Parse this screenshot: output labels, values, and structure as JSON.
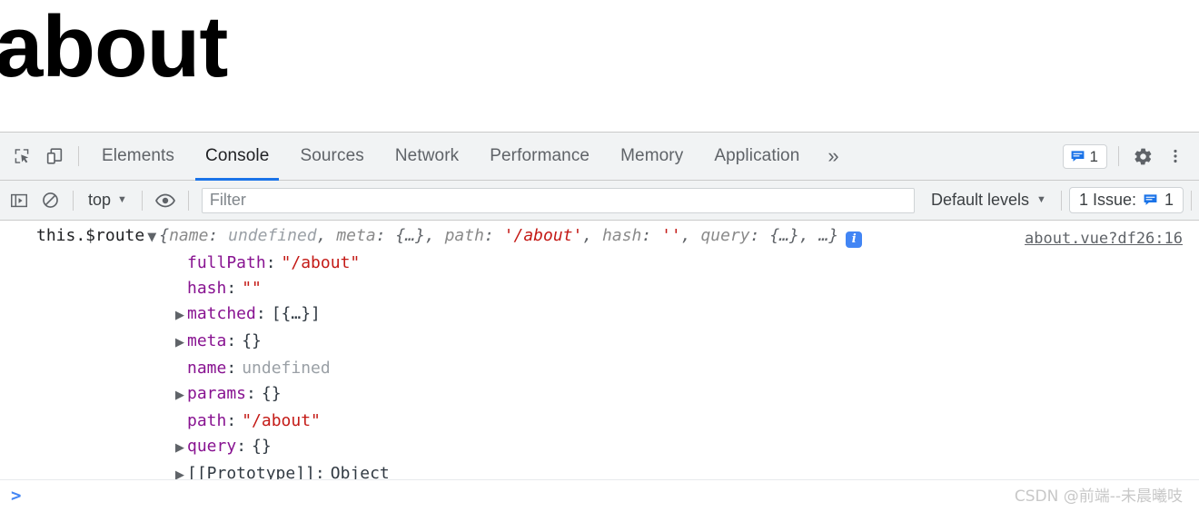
{
  "page": {
    "heading": "about"
  },
  "devtools": {
    "left_controls": [
      {
        "name": "inspect-element-icon",
        "label": "Inspect element"
      },
      {
        "name": "device-toolbar-icon",
        "label": "Toggle device toolbar"
      }
    ],
    "tabs": [
      {
        "id": "elements",
        "label": "Elements",
        "active": false
      },
      {
        "id": "console",
        "label": "Console",
        "active": true
      },
      {
        "id": "sources",
        "label": "Sources",
        "active": false
      },
      {
        "id": "network",
        "label": "Network",
        "active": false
      },
      {
        "id": "performance",
        "label": "Performance",
        "active": false
      },
      {
        "id": "memory",
        "label": "Memory",
        "active": false
      },
      {
        "id": "application",
        "label": "Application",
        "active": false
      }
    ],
    "more_tabs_label": "»",
    "message_badge": {
      "icon": "message-icon",
      "count": "1"
    },
    "settings_label": "Settings",
    "menu_label": "Customize and control DevTools",
    "accent_color": "#1a73e8"
  },
  "console_toolbar": {
    "sidebar_toggle": "console-sidebar-icon",
    "clear_console": "clear-console-icon",
    "context": {
      "value": "top",
      "caret": "▼"
    },
    "eye_icon": "live-expression-eye-icon",
    "filter": {
      "value": "",
      "placeholder": "Filter"
    },
    "levels": {
      "value": "Default levels",
      "caret": "▼"
    },
    "issues": {
      "label": "1 Issue:",
      "icon": "message-icon",
      "count": "1"
    }
  },
  "console_log": {
    "expression": "this.$route",
    "expand_triangle": "▼",
    "preview": {
      "open": "{",
      "parts": [
        {
          "key": "name",
          "sep": ": ",
          "value": "undefined",
          "type": "undefined",
          "tail": ", "
        },
        {
          "key": "meta",
          "sep": ": ",
          "value": "{…}",
          "type": "object",
          "tail": ", "
        },
        {
          "key": "path",
          "sep": ": ",
          "value": "'/about'",
          "type": "string",
          "tail": ", "
        },
        {
          "key": "hash",
          "sep": ": ",
          "value": "''",
          "type": "string",
          "tail": ", "
        },
        {
          "key": "query",
          "sep": ": ",
          "value": "{…}",
          "type": "object",
          "tail": ", "
        }
      ],
      "ellipsis": "…",
      "close": "}"
    },
    "info_icon_glyph": "i",
    "source_link": "about.vue?df26:16",
    "properties": [
      {
        "triangle": "",
        "name": "fullPath",
        "value": "\"/about\"",
        "type": "string"
      },
      {
        "triangle": "",
        "name": "hash",
        "value": "\"\"",
        "type": "string"
      },
      {
        "triangle": "▶",
        "name": "matched",
        "value": "[{…}]",
        "type": "plain"
      },
      {
        "triangle": "▶",
        "name": "meta",
        "value": "{}",
        "type": "plain"
      },
      {
        "triangle": "",
        "name": "name",
        "value": "undefined",
        "type": "undefined"
      },
      {
        "triangle": "▶",
        "name": "params",
        "value": "{}",
        "type": "plain"
      },
      {
        "triangle": "",
        "name": "path",
        "value": "\"/about\"",
        "type": "string"
      },
      {
        "triangle": "▶",
        "name": "query",
        "value": "{}",
        "type": "plain"
      },
      {
        "triangle": "▶",
        "name": "[[Prototype]]",
        "value": "Object",
        "type": "obj",
        "proto": true
      }
    ]
  },
  "prompt": {
    "caret": ">",
    "value": ""
  },
  "watermark": "CSDN @前端--未晨曦吱"
}
